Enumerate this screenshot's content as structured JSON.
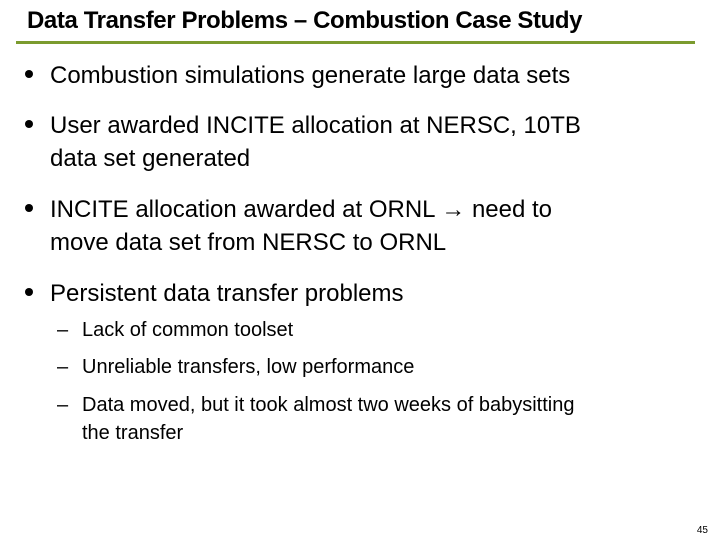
{
  "slide": {
    "title": "Data Transfer Problems – Combustion Case Study",
    "accent_color": "#7b9b2e",
    "bullets": [
      {
        "text": "Combustion simulations generate large data sets"
      },
      {
        "text": "User awarded INCITE allocation at NERSC, 10TB\ndata set generated"
      },
      {
        "text": "INCITE allocation awarded at ORNL → need to\nmove data set from NERSC to ORNL"
      },
      {
        "text": "Persistent data transfer problems"
      }
    ],
    "sub_bullets": [
      {
        "marker": "–",
        "text": "Lack of common toolset"
      },
      {
        "marker": "–",
        "text": "Unreliable transfers, low performance"
      },
      {
        "marker": "–",
        "text": "Data moved, but it took almost two weeks of babysitting\nthe transfer"
      }
    ],
    "page_number": "45"
  }
}
